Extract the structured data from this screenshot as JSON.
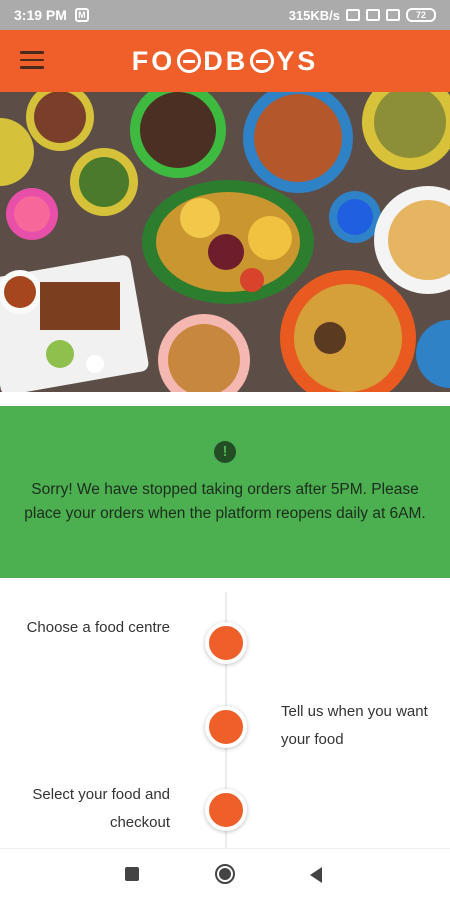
{
  "status_bar": {
    "time": "3:19 PM",
    "network_speed": "315KB/s",
    "battery": "72"
  },
  "app_bar": {
    "logo_text_left": "FO",
    "logo_text_mid": "DB",
    "logo_text_right": "YS",
    "menu_icon": "hamburger-menu-icon"
  },
  "banner": {
    "icon": "exclamation-icon",
    "icon_glyph": "!",
    "message": "Sorry! We have stopped taking orders after 5PM. Please place your orders when the platform reopens daily at 6AM."
  },
  "steps": [
    {
      "label": "Choose a food centre",
      "side": "left"
    },
    {
      "label": "Tell us when you want your food",
      "side": "right"
    },
    {
      "label": "Select your food and checkout",
      "side": "left"
    }
  ],
  "colors": {
    "brand_orange": "#ee5f2a",
    "banner_green": "#4caf50"
  }
}
